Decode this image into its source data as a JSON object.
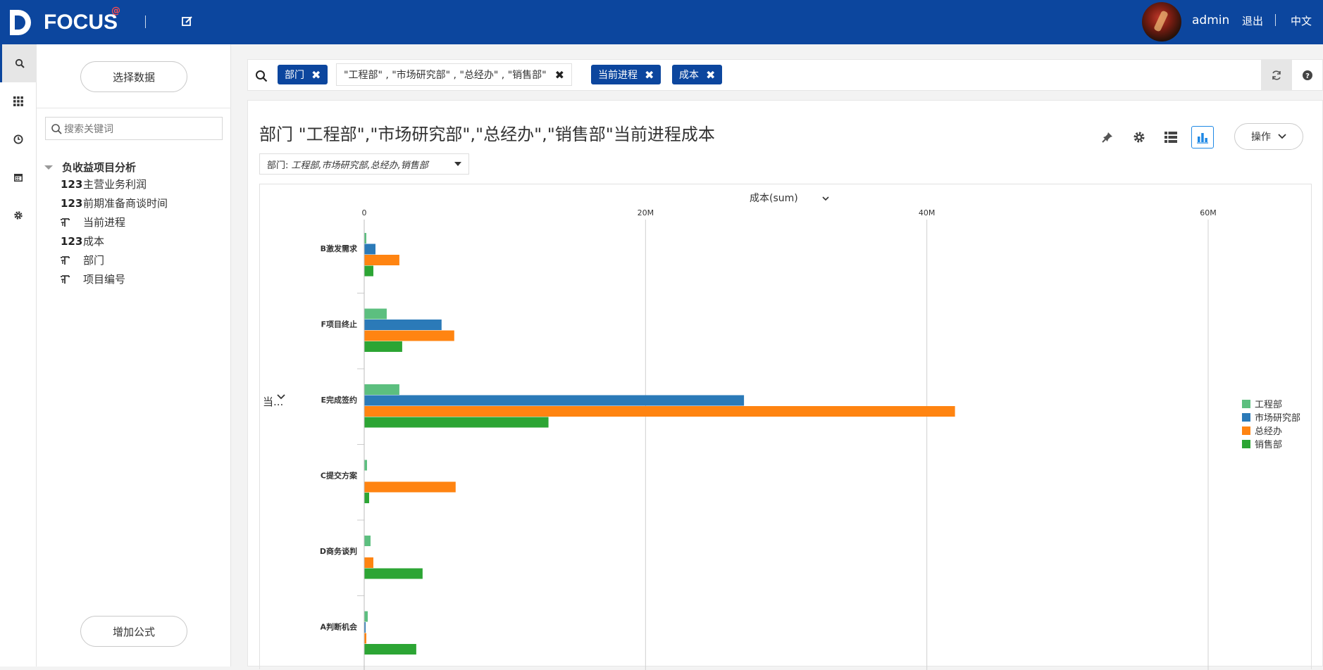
{
  "app": {
    "logo_text": "FOCUS",
    "logo_mark": "@",
    "user": "admin",
    "logout": "退出",
    "language": "中文"
  },
  "panel": {
    "select_data": "选择数据",
    "search_placeholder": "搜索关键词",
    "tree_root": "负收益项目分析",
    "fields": [
      {
        "type": "123",
        "label": "主营业务利润"
      },
      {
        "type": "123",
        "label": "前期准备商谈时间"
      },
      {
        "type": "text",
        "label": "当前进程"
      },
      {
        "type": "123",
        "label": "成本"
      },
      {
        "type": "text",
        "label": "部门"
      },
      {
        "type": "text",
        "label": "项目编号"
      }
    ],
    "add_formula": "增加公式"
  },
  "filterbar": {
    "chips": [
      "部门",
      "\"工程部\" , \"市场研究部\" , \"总经办\" , \"销售部\"",
      "当前进程",
      "成本"
    ]
  },
  "card": {
    "title": "部门 \"工程部\",\"市场研究部\",\"总经办\",\"销售部\"当前进程成本",
    "filter_label": "部门:",
    "filter_value": "工程部,市场研究部,总经办,销售部",
    "operate": "操作",
    "y_selector": "当..."
  },
  "colors": {
    "topbar": "#0c469e",
    "accent": "#1e88e5",
    "chip": "#0c469e"
  },
  "chart_data": {
    "type": "bar",
    "orientation": "horizontal",
    "title": "成本(sum)",
    "xlabel": "成本(sum)",
    "ylabel": "当...",
    "xlim": [
      0,
      60000000
    ],
    "x_ticks": [
      "0",
      "20M",
      "40M",
      "60M"
    ],
    "grid": true,
    "legend_position": "right",
    "categories": [
      "B激发需求",
      "F项目终止",
      "E完成签约",
      "C提交方案",
      "D商务谈判",
      "A判断机会"
    ],
    "series": [
      {
        "name": "工程部",
        "color": "#5cbf7f",
        "values": [
          150000,
          1600000,
          2500000,
          200000,
          450000,
          250000
        ]
      },
      {
        "name": "市场研究部",
        "color": "#2b7ab8",
        "values": [
          800000,
          5500000,
          27000000,
          0,
          0,
          100000
        ]
      },
      {
        "name": "总经办",
        "color": "#ff8411",
        "values": [
          2500000,
          6400000,
          42000000,
          6500000,
          650000,
          150000
        ]
      },
      {
        "name": "销售部",
        "color": "#2ca534",
        "values": [
          650000,
          2700000,
          13100000,
          350000,
          4150000,
          3700000
        ]
      }
    ]
  }
}
